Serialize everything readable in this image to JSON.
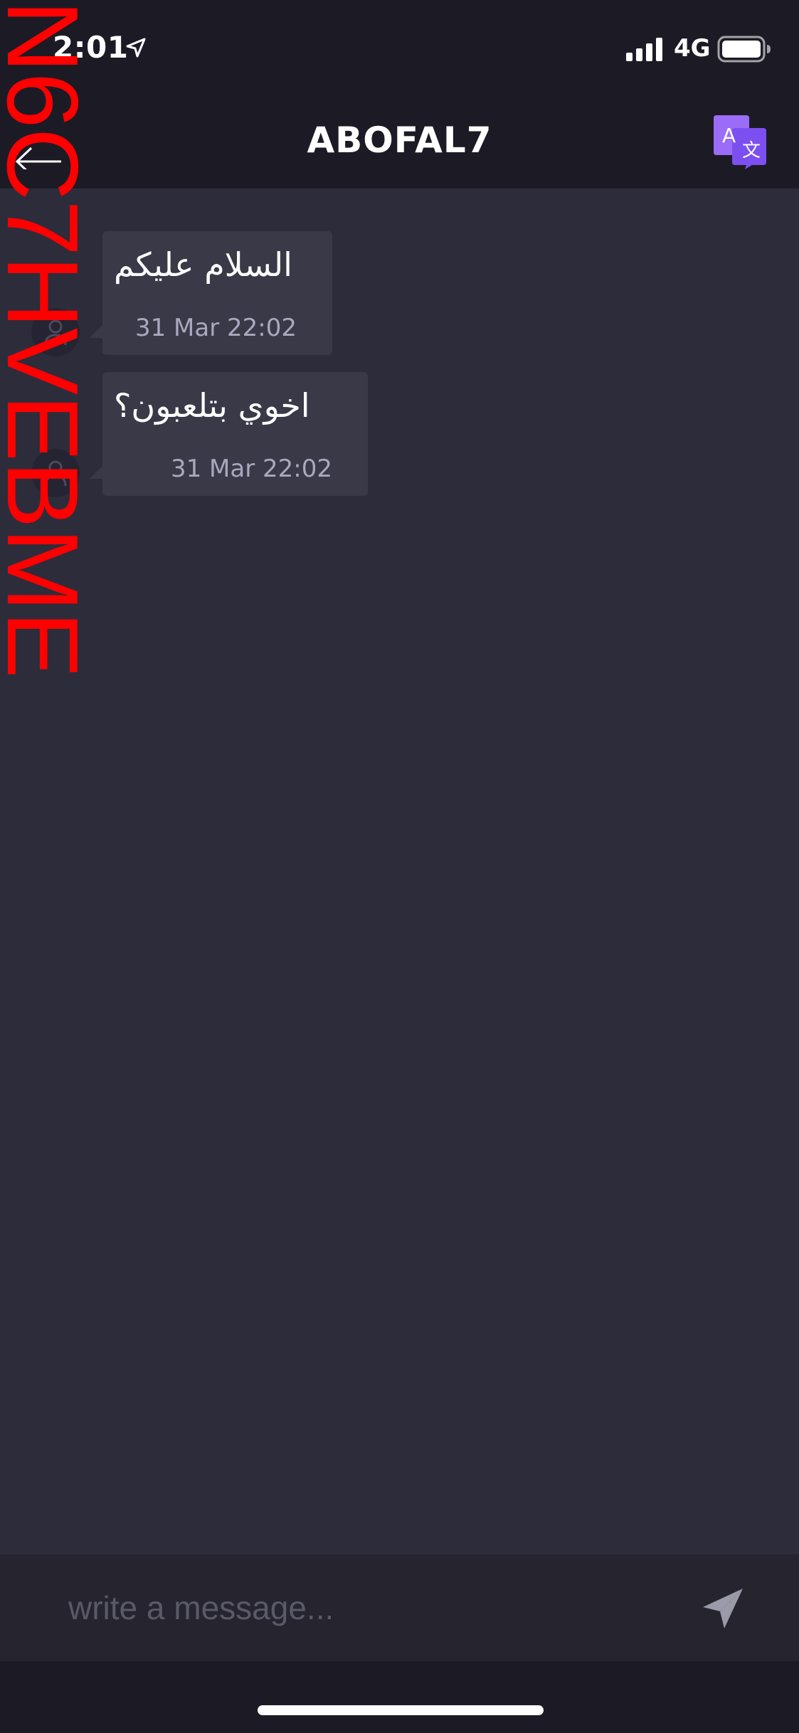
{
  "status_bar": {
    "time": "2:01",
    "network": "4G",
    "location_icon": "location-arrow-icon",
    "signal_icon": "cellular-signal-icon",
    "battery_icon": "battery-icon"
  },
  "header": {
    "title": "ABOFAL7",
    "back_icon": "back-arrow-icon",
    "translate_icon": "translate-icon",
    "translate_letter": "A",
    "translate_glyph": "文"
  },
  "messages": [
    {
      "text": "السلام عليكم",
      "timestamp": "31 Mar 22:02",
      "avatar_icon": "user-avatar-icon"
    },
    {
      "text": "اخوي بتلعبون؟",
      "timestamp": "31 Mar 22:02",
      "avatar_icon": "user-avatar-icon"
    }
  ],
  "compose": {
    "placeholder": "write a message...",
    "value": "",
    "send_icon": "send-icon"
  },
  "watermark": {
    "text": "N6C7HVEBME"
  },
  "colors": {
    "background": "#2d2c3a",
    "header_background": "#1c1b25",
    "bubble": "#3a3948",
    "timestamp": "#a9a8bd",
    "compose_background": "#25242f",
    "placeholder": "#5a5967",
    "translate_accent": "#8b5cf6",
    "watermark": "#ff0000"
  }
}
